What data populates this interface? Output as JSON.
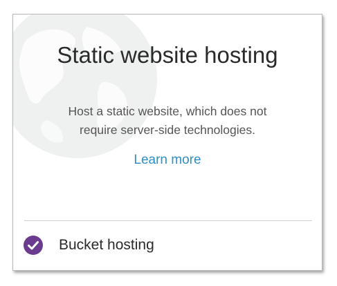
{
  "card": {
    "title": "Static website hosting",
    "description_line1": "Host a static website, which does not",
    "description_line2": "require server-side technologies.",
    "learn_more_label": "Learn more",
    "option_label": "Bucket hosting",
    "option_selected": true,
    "option_icon": "check-circle-icon",
    "background_icon": "globe-icon"
  },
  "colors": {
    "accent_link": "#2b8fca",
    "check_fill": "#6b3b8f",
    "title_text": "#2a2a2a",
    "description_text": "#555555"
  }
}
